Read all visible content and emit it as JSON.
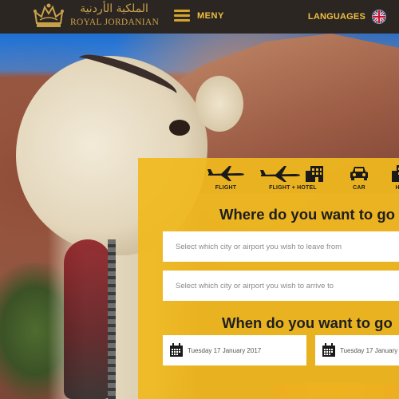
{
  "header": {
    "brand_arabic": "الملكية الأردنية",
    "brand_english": "ROYAL JORDANIAN",
    "menu_label": "MENY",
    "languages_label": "LANGUAGES"
  },
  "booking": {
    "modes": [
      {
        "label": "FLIGHT",
        "icon": "airplane-icon"
      },
      {
        "label": "FLIGHT + HOTEL",
        "icon": "airplane-hotel-icon"
      },
      {
        "label": "CAR",
        "icon": "car-icon"
      },
      {
        "label": "HO",
        "icon": "hotel-icon"
      }
    ],
    "where_heading": "Where do you want to go",
    "from_placeholder": "Select which city or airport you wish to leave from",
    "to_placeholder": "Select which city or airport you wish to arrive to",
    "when_heading": "When do you want to go",
    "depart_date": "Tuesday 17 January 2017",
    "return_date": "Tuesday 17 January"
  },
  "colors": {
    "accent_gold": "#f0c040",
    "panel_yellow": "#f0b91e",
    "nav_dark": "#282421"
  }
}
